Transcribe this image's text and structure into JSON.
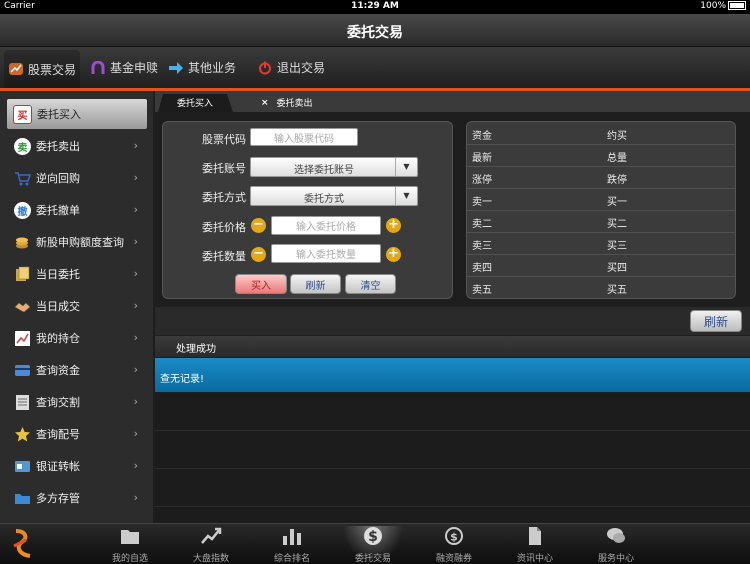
{
  "status_bar": {
    "carrier": "Carrier",
    "time": "11:29 AM",
    "battery": "100%"
  },
  "title_bar": {
    "title": "委托交易"
  },
  "top_nav": [
    {
      "label": "股票交易",
      "icon": "stock-icon"
    },
    {
      "label": "基金申赎",
      "icon": "magnet-icon"
    },
    {
      "label": "其他业务",
      "icon": "arrow-right-icon"
    },
    {
      "label": "退出交易",
      "icon": "power-icon"
    }
  ],
  "sidebar": {
    "items": [
      {
        "label": "委托买入",
        "icon": "买",
        "icon_color": "#d42b2b"
      },
      {
        "label": "委托卖出",
        "icon": "卖",
        "icon_color": "#2a9a3a"
      },
      {
        "label": "逆向回购",
        "icon": "cart",
        "icon_color": "#3a6ac8"
      },
      {
        "label": "委托撤单",
        "icon": "撤",
        "icon_color": "#2a7ad8"
      },
      {
        "label": "新股申购额度查询",
        "icon": "coins",
        "icon_color": "#c88a2a"
      },
      {
        "label": "当日委托",
        "icon": "docs",
        "icon_color": "#c8a84a"
      },
      {
        "label": "当日成交",
        "icon": "handshake",
        "icon_color": "#d8a86a"
      },
      {
        "label": "我的持仓",
        "icon": "chart",
        "icon_color": "#c84a4a"
      },
      {
        "label": "查询资金",
        "icon": "card",
        "icon_color": "#4a8ad8"
      },
      {
        "label": "查询交割",
        "icon": "list",
        "icon_color": "#aaaaaa"
      },
      {
        "label": "查询配号",
        "icon": "star",
        "icon_color": "#e8c23a"
      },
      {
        "label": "银证转帐",
        "icon": "bank",
        "icon_color": "#4a9ad8"
      },
      {
        "label": "多方存管",
        "icon": "folder",
        "icon_color": "#3a8ad8"
      }
    ]
  },
  "tabs": [
    {
      "label": "委托买入"
    },
    {
      "label": "委托卖出"
    }
  ],
  "form": {
    "code_label": "股票代码",
    "code_placeholder": "输入股票代码",
    "account_label": "委托账号",
    "account_value": "选择委托账号",
    "method_label": "委托方式",
    "method_value": "委托方式",
    "price_label": "委托价格",
    "price_placeholder": "输入委托价格",
    "qty_label": "委托数量",
    "qty_placeholder": "输入委托数量",
    "minus": "−",
    "plus": "+",
    "buy_button": "买入",
    "refresh_button": "刷新",
    "clear_button": "清空"
  },
  "quote": {
    "rows": [
      {
        "left": "资金",
        "right": "约买"
      },
      {
        "left": "最新",
        "right": "总量"
      },
      {
        "left": "涨停",
        "right": "跌停"
      },
      {
        "left": "卖一",
        "right": "买一"
      },
      {
        "left": "卖二",
        "right": "买二"
      },
      {
        "left": "卖三",
        "right": "买三"
      },
      {
        "left": "卖四",
        "right": "买四"
      },
      {
        "left": "卖五",
        "right": "买五"
      }
    ]
  },
  "result": {
    "refresh_label": "刷新",
    "header": "处理成功",
    "message": "查无记录!"
  },
  "bottom_bar": {
    "items": [
      {
        "label": "我的自选",
        "icon": "folder-icon"
      },
      {
        "label": "大盘指数",
        "icon": "trend-icon"
      },
      {
        "label": "综合排名",
        "icon": "bar-chart-icon"
      },
      {
        "label": "委托交易",
        "icon": "dollar-icon"
      },
      {
        "label": "融资融券",
        "icon": "loan-icon"
      },
      {
        "label": "资讯中心",
        "icon": "document-icon"
      },
      {
        "label": "服务中心",
        "icon": "chat-icon"
      }
    ]
  },
  "colors": {
    "accent": "#e0541a",
    "highlight_row": "#1a8ac8",
    "button_yellow": "#e4a817"
  }
}
